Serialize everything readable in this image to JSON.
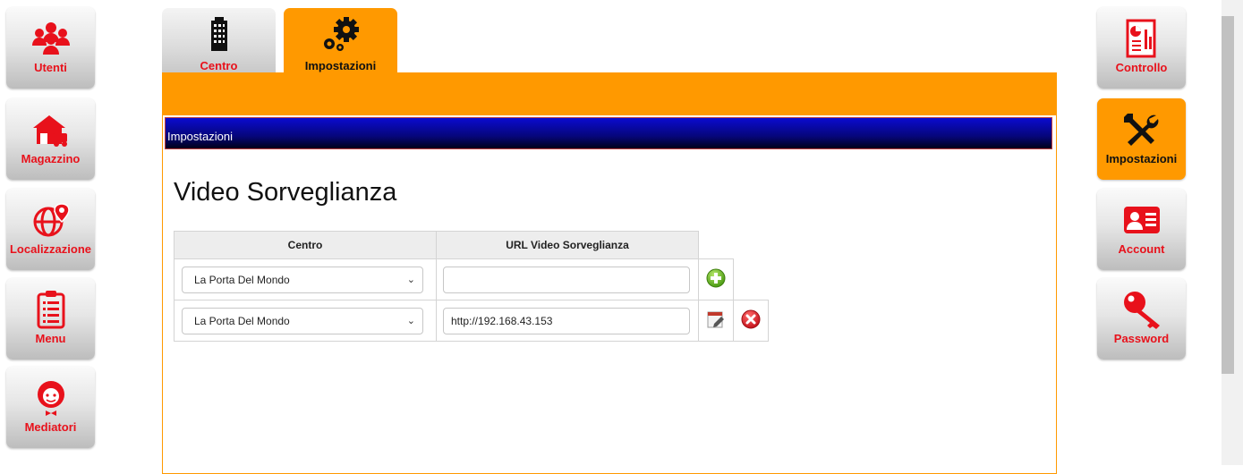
{
  "left_nav": [
    {
      "label": "Utenti",
      "icon": "users-icon"
    },
    {
      "label": "Magazzino",
      "icon": "warehouse-truck-icon"
    },
    {
      "label": "Localizzazione",
      "icon": "globe-pin-icon"
    },
    {
      "label": "Menu",
      "icon": "clipboard-list-icon"
    },
    {
      "label": "Mediatori",
      "icon": "mediator-headset-icon"
    }
  ],
  "right_nav": [
    {
      "label": "Controllo",
      "icon": "report-chart-icon"
    },
    {
      "label": "Impostazioni",
      "icon": "tools-icon",
      "active": true
    },
    {
      "label": "Account",
      "icon": "id-card-icon"
    },
    {
      "label": "Password",
      "icon": "key-icon"
    }
  ],
  "tabs": [
    {
      "label": "Centro",
      "icon": "building-icon"
    },
    {
      "label": "Impostazioni",
      "icon": "gears-icon",
      "active": true
    }
  ],
  "panel": {
    "header": "Impostazioni",
    "title": "Video Sorveglianza",
    "table": {
      "headers": [
        "Centro",
        "URL Video Sorveglianza"
      ],
      "new_row": {
        "centro": "La Porta Del Mondo",
        "url": ""
      },
      "rows": [
        {
          "centro": "La Porta Del Mondo",
          "url": "http://192.168.43.153"
        }
      ]
    }
  },
  "colors": {
    "accent": "#ff9900",
    "brand_red": "#e8111b",
    "header_blue": "#0b0bd0"
  }
}
